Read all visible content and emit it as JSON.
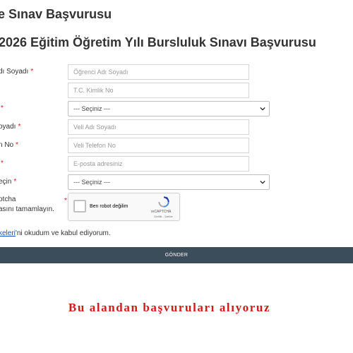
{
  "page": {
    "title": "e Sınav Başvurusu",
    "section_title": "2026 Eğitim Öğretim Yılı Bursluluk Sınavı Başvurusu"
  },
  "form": {
    "student_name": {
      "label": "dı Soyadı",
      "required": "*",
      "placeholder": "Öğrenci Adı Soyadı"
    },
    "tc_no": {
      "placeholder": "T.C. Kimlik No"
    },
    "select_1": {
      "label": "",
      "required": "*",
      "value": "--- Seçiniz ---"
    },
    "parent_name": {
      "label": "oyadı",
      "required": "*",
      "placeholder": "Veli Adı Soyadı"
    },
    "parent_phone": {
      "label": "n No",
      "required": "*",
      "placeholder": "Veli Telefon No"
    },
    "email": {
      "label": "",
      "required": "*",
      "placeholder": "E-posta adresiniz"
    },
    "select_2": {
      "label": "eçin",
      "required": "*",
      "value": "--- Seçiniz ---"
    },
    "captcha": {
      "label_line1": "otcha",
      "label_line2": "asını tamamlayın.",
      "required": "*",
      "checkbox_label": "Ben robot değilim",
      "brand": "reCAPTCHA",
      "terms": "Gizlilik - Şartlar"
    },
    "terms": {
      "link_text": "keleri",
      "rest": "'ni okudum ve kabul ediyorum."
    },
    "submit_label": "GÖNDER"
  },
  "note": "Bu alandan başvuruları alıyoruz",
  "colors": {
    "submit_bg": "#3b4c5b",
    "required": "#d01f2b",
    "note": "#d11a1a",
    "link": "#1a4fb5"
  }
}
